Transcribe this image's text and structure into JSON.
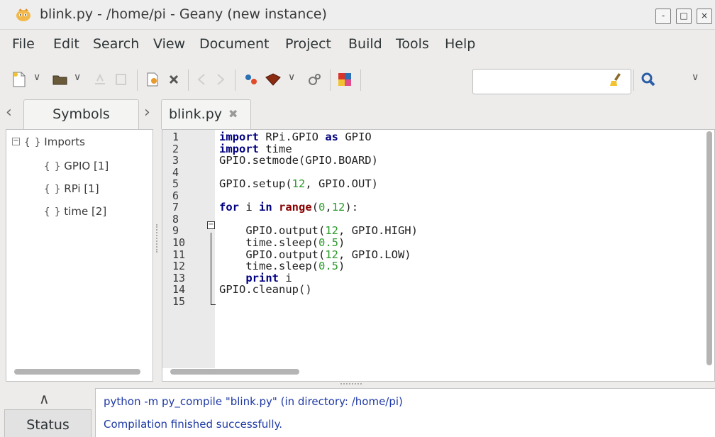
{
  "window": {
    "title": "blink.py - /home/pi - Geany (new instance)",
    "buttons": {
      "minimize": "-",
      "maximize": "□",
      "close": "×"
    }
  },
  "menu": [
    "File",
    "Edit",
    "Search",
    "View",
    "Document",
    "Project",
    "Build",
    "Tools",
    "Help"
  ],
  "toolbar": {
    "icons": [
      "new-file-icon",
      "open-file-icon",
      "save-icon",
      "save-all-icon",
      "revert-icon",
      "close-icon",
      "back-icon",
      "forward-icon",
      "compile-icon",
      "build-icon",
      "execute-icon",
      "color-chooser-icon",
      "clear-icon",
      "search-icon"
    ],
    "search_value": ""
  },
  "sidebar": {
    "tab_label": "Symbols",
    "tree": {
      "root": "Imports",
      "children": [
        "GPIO [1]",
        "RPi [1]",
        "time [2]"
      ]
    }
  },
  "editor": {
    "tab_label": "blink.py",
    "line_numbers": [
      "1",
      "2",
      "3",
      "4",
      "5",
      "6",
      "7",
      "8",
      "9",
      "10",
      "11",
      "12",
      "13",
      "14",
      "15"
    ],
    "code": [
      [
        {
          "t": "kw",
          "v": "import"
        },
        {
          "t": "plain",
          "v": " RPi.GPIO "
        },
        {
          "t": "kw",
          "v": "as"
        },
        {
          "t": "plain",
          "v": " GPIO"
        }
      ],
      [
        {
          "t": "kw",
          "v": "import"
        },
        {
          "t": "plain",
          "v": " time"
        }
      ],
      [
        {
          "t": "plain",
          "v": "GPIO.setmode(GPIO.BOARD)"
        }
      ],
      [],
      [
        {
          "t": "plain",
          "v": "GPIO.setup("
        },
        {
          "t": "num",
          "v": "12"
        },
        {
          "t": "plain",
          "v": ", GPIO.OUT)"
        }
      ],
      [],
      [
        {
          "t": "kw",
          "v": "for"
        },
        {
          "t": "plain",
          "v": " i "
        },
        {
          "t": "kw",
          "v": "in"
        },
        {
          "t": "plain",
          "v": " "
        },
        {
          "t": "kw2",
          "v": "range"
        },
        {
          "t": "plain",
          "v": "("
        },
        {
          "t": "num",
          "v": "0"
        },
        {
          "t": "plain",
          "v": ","
        },
        {
          "t": "num",
          "v": "12"
        },
        {
          "t": "plain",
          "v": "):"
        }
      ],
      [],
      [
        {
          "t": "plain",
          "v": "    GPIO.output("
        },
        {
          "t": "num",
          "v": "12"
        },
        {
          "t": "plain",
          "v": ", GPIO.HIGH)"
        }
      ],
      [
        {
          "t": "plain",
          "v": "    time.sleep("
        },
        {
          "t": "num",
          "v": "0.5"
        },
        {
          "t": "plain",
          "v": ")"
        }
      ],
      [
        {
          "t": "plain",
          "v": "    GPIO.output("
        },
        {
          "t": "num",
          "v": "12"
        },
        {
          "t": "plain",
          "v": ", GPIO.LOW)"
        }
      ],
      [
        {
          "t": "plain",
          "v": "    time.sleep("
        },
        {
          "t": "num",
          "v": "0.5"
        },
        {
          "t": "plain",
          "v": ")"
        }
      ],
      [
        {
          "t": "plain",
          "v": "    "
        },
        {
          "t": "kw",
          "v": "print"
        },
        {
          "t": "plain",
          "v": " i"
        }
      ],
      [
        {
          "t": "plain",
          "v": "GPIO.cleanup()"
        }
      ],
      []
    ]
  },
  "messages": {
    "tab_label": "Status",
    "lines": [
      "python -m py_compile \"blink.py\" (in directory: /home/pi)",
      "Compilation finished successfully."
    ]
  }
}
